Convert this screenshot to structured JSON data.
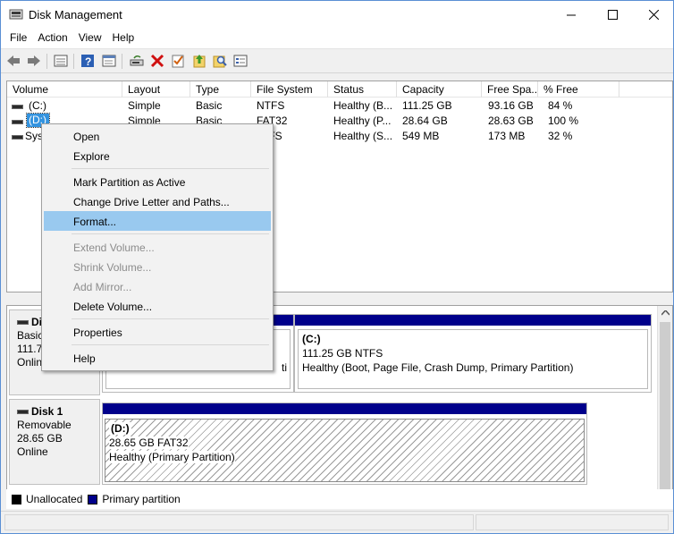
{
  "window": {
    "title": "Disk Management"
  },
  "menu": [
    "File",
    "Action",
    "View",
    "Help"
  ],
  "toolbar": {
    "icons": [
      "back-arrow-icon",
      "forward-arrow-icon",
      "list-view-icon",
      "help-icon",
      "properties-icon",
      "rescan-disks-icon",
      "delete-icon",
      "check-icon",
      "import-icon",
      "find-icon",
      "settings-list-icon"
    ]
  },
  "volume_list": {
    "columns": [
      "Volume",
      "Layout",
      "Type",
      "File System",
      "Status",
      "Capacity",
      "Free Spa...",
      "% Free"
    ],
    "rows": [
      {
        "volume": "(C:)",
        "layout": "Simple",
        "type": "Basic",
        "fs": "NTFS",
        "status": "Healthy (B...",
        "capacity": "111.25 GB",
        "free": "93.16 GB",
        "pct": "84 %"
      },
      {
        "volume": "(D:)",
        "layout": "Simple",
        "type": "Basic",
        "fs": "FAT32",
        "status": "Healthy (P...",
        "capacity": "28.64 GB",
        "free": "28.63 GB",
        "pct": "100 %"
      },
      {
        "volume": "Syst",
        "layout": "",
        "type": "",
        "fs": "TFS",
        "status": "Healthy (S...",
        "capacity": "549 MB",
        "free": "173 MB",
        "pct": "32 %"
      }
    ]
  },
  "disks": [
    {
      "name": "Di",
      "type": "Basic",
      "size": "111.7",
      "state": "Onlin",
      "partitions": [
        {
          "line3": "ti"
        },
        {
          "name": "(C:)",
          "detail": "111.25 GB NTFS",
          "status": "Healthy (Boot, Page File, Crash Dump, Primary Partition)"
        }
      ]
    },
    {
      "name": "Disk 1",
      "type": "Removable",
      "size": "28.65 GB",
      "state": "Online",
      "partitions": [
        {
          "name": "(D:)",
          "detail": "28.65 GB FAT32",
          "status": "Healthy (Primary Partition)"
        }
      ]
    }
  ],
  "legend": [
    {
      "label": "Unallocated",
      "color": "#000000"
    },
    {
      "label": "Primary partition",
      "color": "#00008b"
    }
  ],
  "context_menu": {
    "items": [
      {
        "label": "Open",
        "disabled": false
      },
      {
        "label": "Explore",
        "disabled": false
      },
      {
        "label": "Mark Partition as Active",
        "disabled": false
      },
      {
        "label": "Change Drive Letter and Paths...",
        "disabled": false
      },
      {
        "label": "Format...",
        "disabled": false,
        "selected": true
      },
      {
        "label": "Extend Volume...",
        "disabled": true
      },
      {
        "label": "Shrink Volume...",
        "disabled": true
      },
      {
        "label": "Add Mirror...",
        "disabled": true
      },
      {
        "label": "Delete Volume...",
        "disabled": false
      },
      {
        "label": "Properties",
        "disabled": false
      },
      {
        "label": "Help",
        "disabled": false
      }
    ]
  },
  "colors": {
    "selection": "#99c9ef",
    "partition_bar": "#00008b",
    "window_border": "#5a8fd4"
  }
}
